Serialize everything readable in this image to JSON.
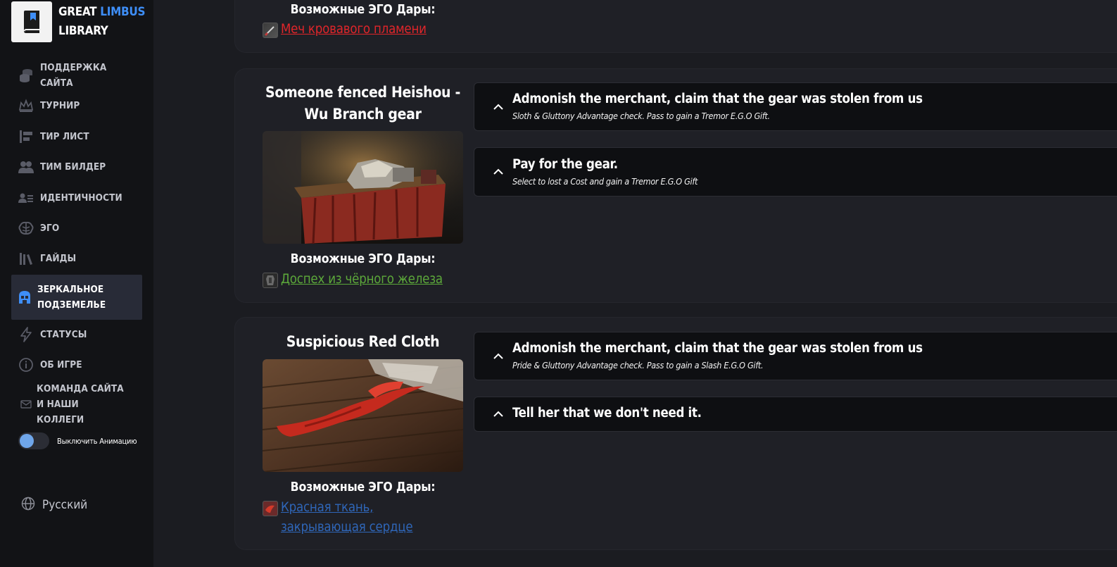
{
  "brand": {
    "line1": "GREAT ",
    "accent": "LIMBUS",
    "line2": "LIBRARY"
  },
  "nav": [
    {
      "label": "ПОДДЕРЖКА САЙТА",
      "icon": "coins-icon"
    },
    {
      "label": "ТУРНИР",
      "icon": "crown-icon"
    },
    {
      "label": "ТИР ЛИСТ",
      "icon": "tier-list-icon"
    },
    {
      "label": "ТИМ БИЛДЕР",
      "icon": "team-icon"
    },
    {
      "label": "ИДЕНТИЧНОСТИ",
      "icon": "identity-icon"
    },
    {
      "label": "ЭГО",
      "icon": "brain-icon"
    },
    {
      "label": "ГАЙДЫ",
      "icon": "books-icon"
    },
    {
      "label": "ЗЕРКАЛЬНОЕ ПОДЗЕМЕЛЬЕ",
      "icon": "dungeon-icon",
      "active": true
    },
    {
      "label": "СТАТУСЫ",
      "icon": "lightning-icon"
    },
    {
      "label": "ОБ ИГРЕ",
      "icon": "info-icon"
    },
    {
      "label": "КОМАНДА САЙТА И НАШИ КОЛЛЕГИ",
      "icon": "mail-icon"
    }
  ],
  "toggle_label": "Выключить Анимацию",
  "language": "Русский",
  "gifts_heading": "Возможные ЭГО Дары:",
  "encounters": [
    {
      "gift": {
        "name": "Меч кровавого пламени",
        "color": "#e0252a"
      }
    },
    {
      "title": "Someone fenced Heishou - Wu Branch gear",
      "choices": [
        {
          "title": "Admonish the merchant, claim that the gear was stolen from us",
          "desc": "Sloth & Gluttony Advantage check. Pass to gain a Tremor E.G.O Gift."
        },
        {
          "title": "Pay for the gear.",
          "desc": "Select to lost a Cost and gain a Tremor E.G.O Gift"
        }
      ],
      "gift": {
        "name": "Доспех из чёрного железа",
        "color": "#5ca83a"
      }
    },
    {
      "title": "Suspicious Red Cloth",
      "choices": [
        {
          "title": "Admonish the merchant, claim that the gear was stolen from us",
          "desc": "Pride & Gluttony Advantage check. Pass to gain a Slash E.G.O Gift."
        },
        {
          "title": "Tell her that we don't need it."
        }
      ],
      "gift": {
        "name": "Красная ткань, закрывающая сердце",
        "color": "#2f66b8"
      }
    }
  ]
}
